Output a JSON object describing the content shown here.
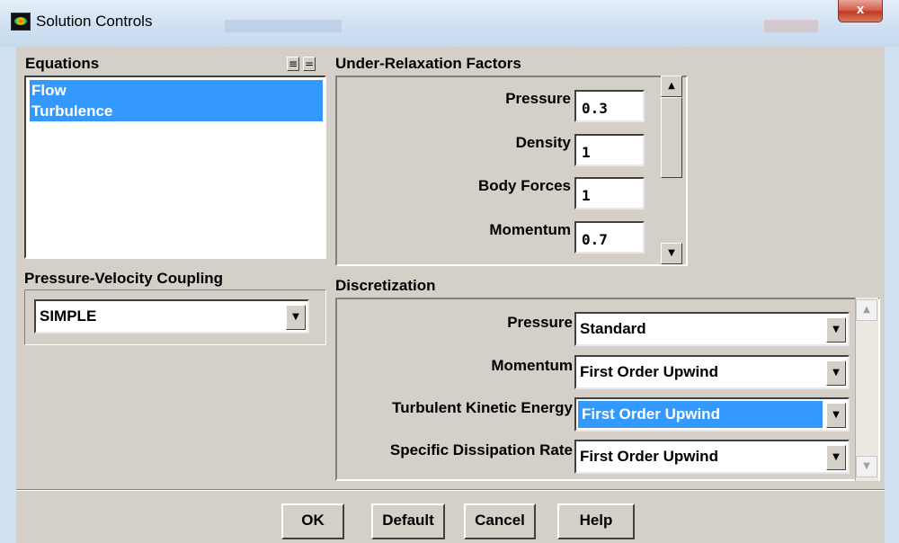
{
  "window": {
    "title": "Solution Controls",
    "close_label": "x"
  },
  "equations": {
    "label": "Equations",
    "items": [
      {
        "label": "Flow",
        "selected": true
      },
      {
        "label": "Turbulence",
        "selected": true
      }
    ]
  },
  "under_relaxation": {
    "label": "Under-Relaxation Factors",
    "fields": [
      {
        "label": "Pressure",
        "value": "0.3"
      },
      {
        "label": "Density",
        "value": "1"
      },
      {
        "label": "Body Forces",
        "value": "1"
      },
      {
        "label": "Momentum",
        "value": "0.7"
      }
    ]
  },
  "pv_coupling": {
    "label": "Pressure-Velocity Coupling",
    "selected": "SIMPLE"
  },
  "discretization": {
    "label": "Discretization",
    "rows": [
      {
        "label": "Pressure",
        "value": "Standard"
      },
      {
        "label": "Momentum",
        "value": "First Order Upwind"
      },
      {
        "label": "Turbulent Kinetic Energy",
        "value": "First Order Upwind"
      },
      {
        "label": "Specific Dissipation Rate",
        "value": "First Order Upwind"
      }
    ]
  },
  "buttons": {
    "ok": "OK",
    "default": "Default",
    "cancel": "Cancel",
    "help": "Help"
  },
  "colors": {
    "selection": "#3399ff",
    "dialog_bg": "#d4d0c8",
    "frame": "#cfe0f1"
  }
}
